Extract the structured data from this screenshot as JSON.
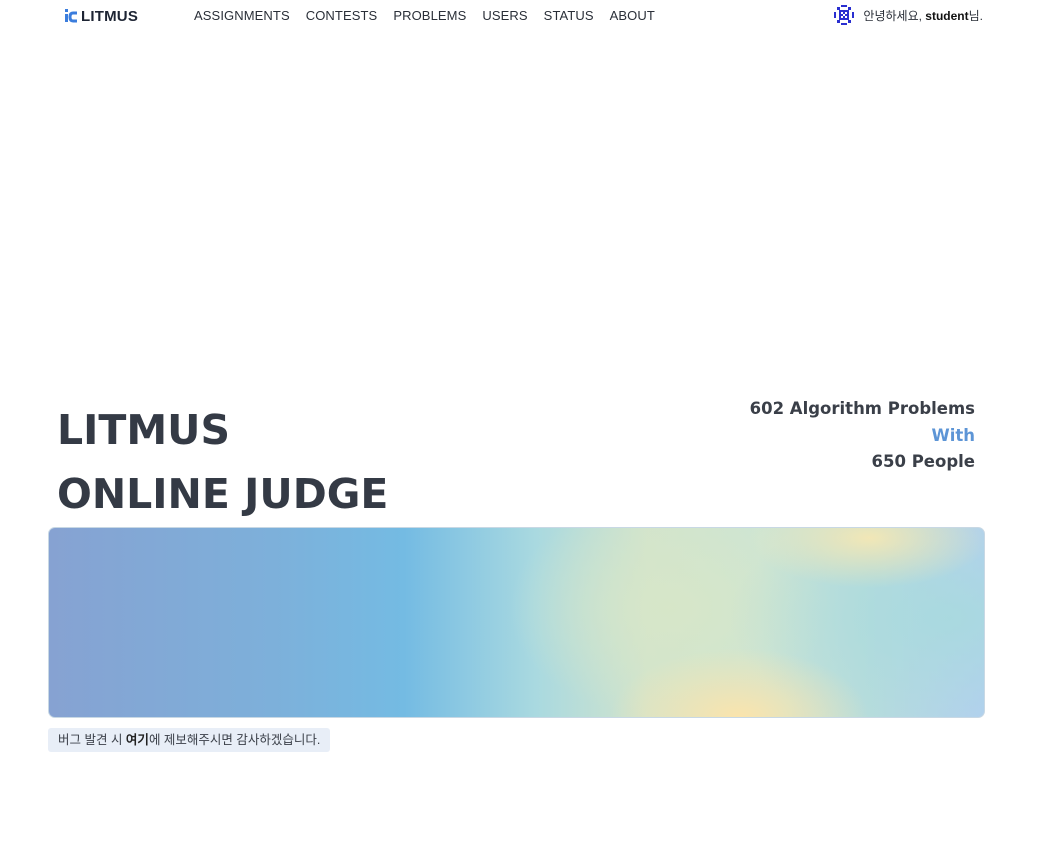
{
  "brand": {
    "name": "LITMUS",
    "accent": "#3b7ddd",
    "logo_icon": "litmus-logo-icon"
  },
  "nav": {
    "items": [
      {
        "label": "ASSIGNMENTS"
      },
      {
        "label": "CONTESTS"
      },
      {
        "label": "PROBLEMS"
      },
      {
        "label": "USERS"
      },
      {
        "label": "STATUS"
      },
      {
        "label": "ABOUT"
      }
    ]
  },
  "user": {
    "greeting_prefix": "안녕하세요, ",
    "username": "student",
    "greeting_suffix": "님.",
    "avatar_icon": "identicon-avatar-icon",
    "avatar_color": "#2a2fd0"
  },
  "hero": {
    "title_line1": "LITMUS",
    "title_line2": "ONLINE JUDGE",
    "stats_line1": "602 Algorithm Problems",
    "stats_line2": "With",
    "stats_line3": "650 People"
  },
  "bug_report": {
    "prefix": "버그 발견 시 ",
    "link_label": "여기",
    "suffix": "에 제보해주시면 감사하겠습니다."
  }
}
